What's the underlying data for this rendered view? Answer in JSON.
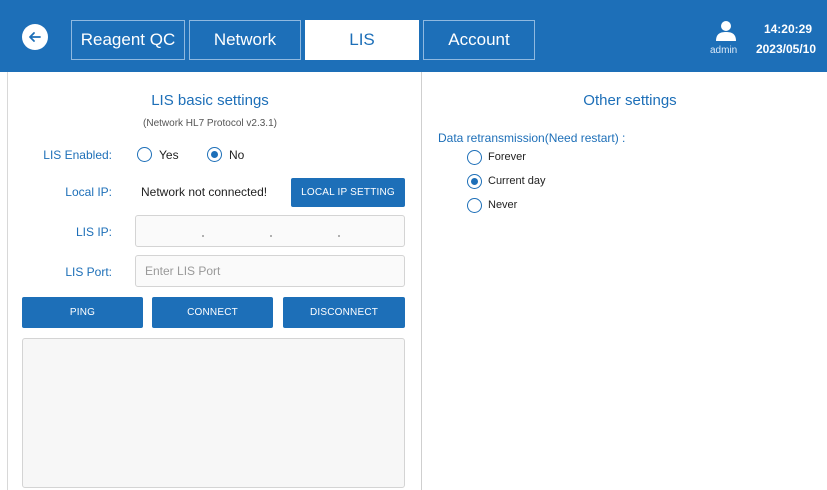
{
  "header": {
    "tabs": [
      {
        "label": "Reagent QC",
        "active": false
      },
      {
        "label": "Network",
        "active": false
      },
      {
        "label": "LIS",
        "active": true
      },
      {
        "label": "Account",
        "active": false
      }
    ],
    "user": "admin",
    "time": "14:20:29",
    "date": "2023/05/10",
    "colors": {
      "primary": "#1d6fb8"
    }
  },
  "lis_basic": {
    "title": "LIS basic settings",
    "subtitle": "(Network HL7 Protocol v2.3.1)",
    "enabled_label": "LIS Enabled:",
    "options": [
      {
        "label": "Yes",
        "checked": false
      },
      {
        "label": "No",
        "checked": true
      }
    ],
    "local_ip_label": "Local IP:",
    "local_ip_value": "Network not connected!",
    "local_ip_button": "LOCAL IP SETTING",
    "lis_ip_label": "LIS IP:",
    "lis_port_label": "LIS Port:",
    "lis_port_placeholder": "Enter LIS Port",
    "buttons": {
      "ping": "PING",
      "connect": "CONNECT",
      "disconnect": "DISCONNECT"
    }
  },
  "other": {
    "title": "Other settings",
    "retrans_label": "Data retransmission(Need restart) :",
    "options": [
      {
        "label": "Forever",
        "checked": false
      },
      {
        "label": "Current day",
        "checked": true
      },
      {
        "label": "Never",
        "checked": false
      }
    ]
  }
}
